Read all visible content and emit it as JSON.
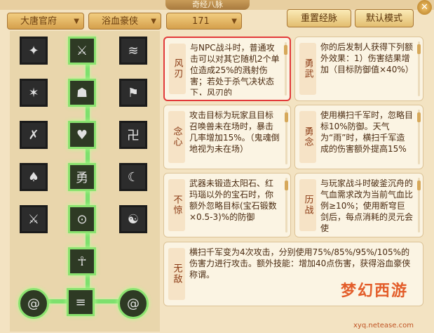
{
  "window": {
    "title": "奇经八脉"
  },
  "toolbar": {
    "faction": "大唐官府",
    "school": "浴血豪侠",
    "points": "171",
    "reset_label": "重置经脉",
    "default_label": "默认模式"
  },
  "cards": [
    {
      "tag": "风刃",
      "text": "与NPC战斗时，普通攻击可以对其它随机2个单位造成25%的溅射伤害；若处于杀气决状态下，风刃的"
    },
    {
      "tag": "勇武",
      "text": "你的后发制人获得下列额外效果：1）伤害结果增加（目标防御值×40%）"
    },
    {
      "tag": "念心",
      "text": "攻击目标为玩家且目标召唤兽未在场时，暴击几率增加15%。（鬼魂倒地视为未在场）"
    },
    {
      "tag": "勇念",
      "text": "使用横扫千军时，忽略目标10%防御。天气为“雨”时，横扫千军造成的伤害额外提高15%"
    },
    {
      "tag": "不惊",
      "text": "武器未锻造太阳石、红玛瑙以外的宝石时，你额外忽略目标(宝石锻数×0.5-3)%的防御"
    },
    {
      "tag": "历战",
      "text": "与玩家战斗时破釜沉舟的气血需求改为当前气血比例≥10%；使用断穹巨剑后，每点消耗的灵元会使"
    },
    {
      "tag": "无敌",
      "text": "横扫千军变为4次攻击，分别使用75%/85%/95%/105%的伤害力进行攻击。额外技能：增加40点伤害，获得浴血豪侠称谓。"
    }
  ],
  "brand": {
    "url": "xyq.netease.com"
  }
}
